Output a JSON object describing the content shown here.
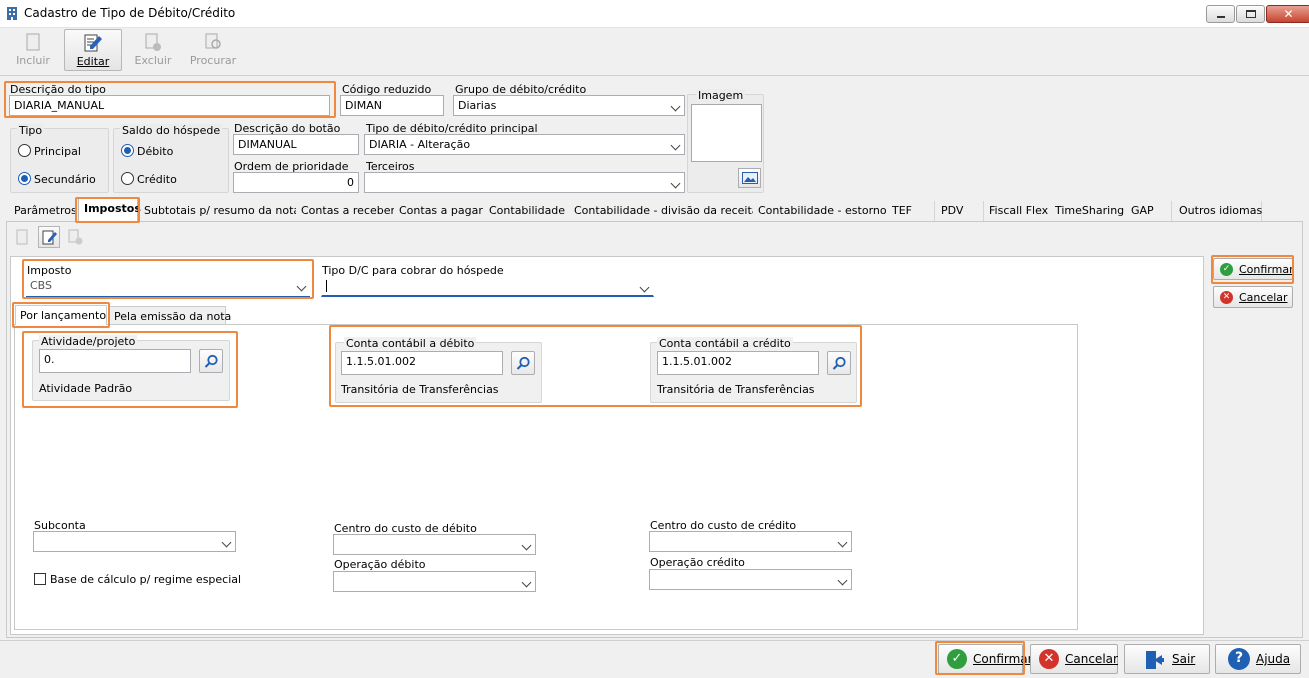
{
  "window": {
    "title": "Cadastro de Tipo de Débito/Crédito"
  },
  "toolbar": {
    "incluir": "Incluir",
    "editar": "Editar",
    "excluir": "Excluir",
    "procurar": "Procurar"
  },
  "form": {
    "descricao_tipo_label": "Descrição do tipo",
    "descricao_tipo_value": "DIARIA_MANUAL",
    "codigo_reduzido_label": "Código reduzido",
    "codigo_reduzido_value": "DIMAN",
    "grupo_label": "Grupo de débito/crédito",
    "grupo_value": "Diarias",
    "imagem_label": "Imagem",
    "tipo_label": "Tipo",
    "tipo_principal": "Principal",
    "tipo_secundario": "Secundário",
    "saldo_label": "Saldo do hóspede",
    "saldo_debito": "Débito",
    "saldo_credito": "Crédito",
    "descricao_botao_label": "Descrição do botão",
    "descricao_botao_value": "DIMANUAL",
    "tipo_principal_label": "Tipo de débito/crédito principal",
    "tipo_principal_value": "DIARIA - Alteração",
    "ordem_label": "Ordem de prioridade",
    "ordem_value": "0",
    "terceiros_label": "Terceiros",
    "terceiros_value": ""
  },
  "tabs": [
    "Parâmetros",
    "Impostos",
    "Subtotais p/ resumo da nota",
    "Contas a receber",
    "Contas a pagar",
    "Contabilidade",
    "Contabilidade - divisão da receita",
    "Contabilidade - estorno",
    "TEF",
    "PDV",
    "Fiscall Flex",
    "TimeSharing",
    "GAP",
    "Outros idiomas"
  ],
  "impostos": {
    "imposto_label": "Imposto",
    "imposto_value": "CBS",
    "tipo_dc_label": "Tipo D/C para cobrar do hóspede",
    "tipo_dc_value": "",
    "subtabs": [
      "Por lançamento",
      "Pela emissão da nota"
    ],
    "atividade_label": "Atividade/projeto",
    "atividade_value": "0.",
    "atividade_desc": "Atividade Padrão",
    "conta_debito_label": "Conta contábil a débito",
    "conta_debito_value": "1.1.5.01.002",
    "conta_debito_desc": "Transitória de Transferências",
    "conta_credito_label": "Conta contábil a crédito",
    "conta_credito_value": "1.1.5.01.002",
    "conta_credito_desc": "Transitória de Transferências",
    "subconta_label": "Subconta",
    "centro_debito_label": "Centro do custo de débito",
    "operacao_debito_label": "Operação débito",
    "centro_credito_label": "Centro do custo de crédito",
    "operacao_credito_label": "Operação crédito",
    "base_calculo_label": "Base de cálculo p/ regime especial"
  },
  "side_buttons": {
    "confirmar": "Confirmar",
    "cancelar": "Cancelar"
  },
  "footer": {
    "confirmar": "Confirmar",
    "cancelar": "Cancelar",
    "sair": "Sair",
    "ajuda": "Ajuda"
  },
  "colors": {
    "highlight": "#f0883f",
    "confirm_green": "#2e9e3e",
    "cancel_red": "#d3332b",
    "help_blue": "#1f5fb4"
  }
}
